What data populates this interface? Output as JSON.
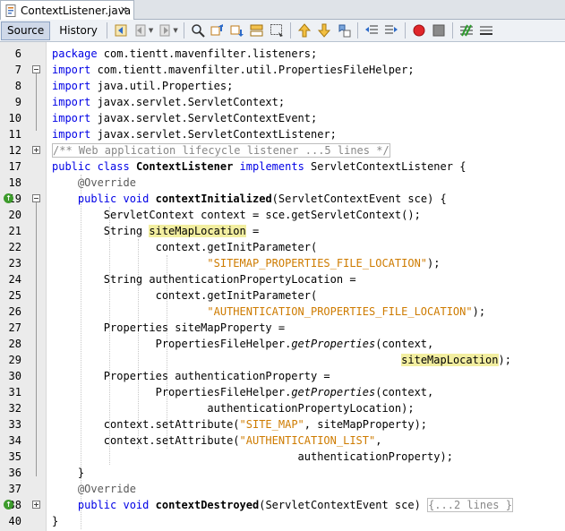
{
  "tab": {
    "title": "ContextListener.java",
    "close": "×"
  },
  "toolbar": {
    "source": "Source",
    "history": "History"
  },
  "lines": [
    {
      "n": "6",
      "t": "package com.tientt.mavenfilter.listeners;"
    },
    {
      "n": "7",
      "t": "import com.tientt.mavenfilter.util.PropertiesFileHelper;"
    },
    {
      "n": "8",
      "t": "import java.util.Properties;"
    },
    {
      "n": "9",
      "t": "import javax.servlet.ServletContext;"
    },
    {
      "n": "10",
      "t": "import javax.servlet.ServletContextEvent;"
    },
    {
      "n": "11",
      "t": "import javax.servlet.ServletContextListener;"
    },
    {
      "n": "12",
      "t": "/** Web application lifecycle listener ...5 lines */"
    },
    {
      "n": "17",
      "t": "public class ContextListener implements ServletContextListener {"
    },
    {
      "n": "18",
      "t": "@Override"
    },
    {
      "n": "19",
      "t": "public void contextInitialized(ServletContextEvent sce) {"
    },
    {
      "n": "20",
      "t": "ServletContext context = sce.getServletContext();"
    },
    {
      "n": "21",
      "t": "String siteMapLocation ="
    },
    {
      "n": "22",
      "t": "context.getInitParameter("
    },
    {
      "n": "23",
      "t": "\"SITEMAP_PROPERTIES_FILE_LOCATION\");"
    },
    {
      "n": "24",
      "t": "String authenticationPropertyLocation ="
    },
    {
      "n": "25",
      "t": "context.getInitParameter("
    },
    {
      "n": "26",
      "t": "\"AUTHENTICATION_PROPERTIES_FILE_LOCATION\");"
    },
    {
      "n": "27",
      "t": "Properties siteMapProperty ="
    },
    {
      "n": "28",
      "t": "PropertiesFileHelper.getProperties(context,"
    },
    {
      "n": "29",
      "t": "siteMapLocation);"
    },
    {
      "n": "30",
      "t": "Properties authenticationProperty ="
    },
    {
      "n": "31",
      "t": "PropertiesFileHelper.getProperties(context,"
    },
    {
      "n": "32",
      "t": "authenticationPropertyLocation);"
    },
    {
      "n": "33",
      "t": "context.setAttribute(\"SITE_MAP\", siteMapProperty);"
    },
    {
      "n": "34",
      "t": "context.setAttribute(\"AUTHENTICATION_LIST\","
    },
    {
      "n": "35",
      "t": "authenticationProperty);"
    },
    {
      "n": "36",
      "t": "}"
    },
    {
      "n": "37",
      "t": "@Override"
    },
    {
      "n": "38",
      "t": "public void contextDestroyed(ServletContextEvent sce) {...2 lines }"
    },
    {
      "n": "40",
      "t": "}"
    }
  ]
}
